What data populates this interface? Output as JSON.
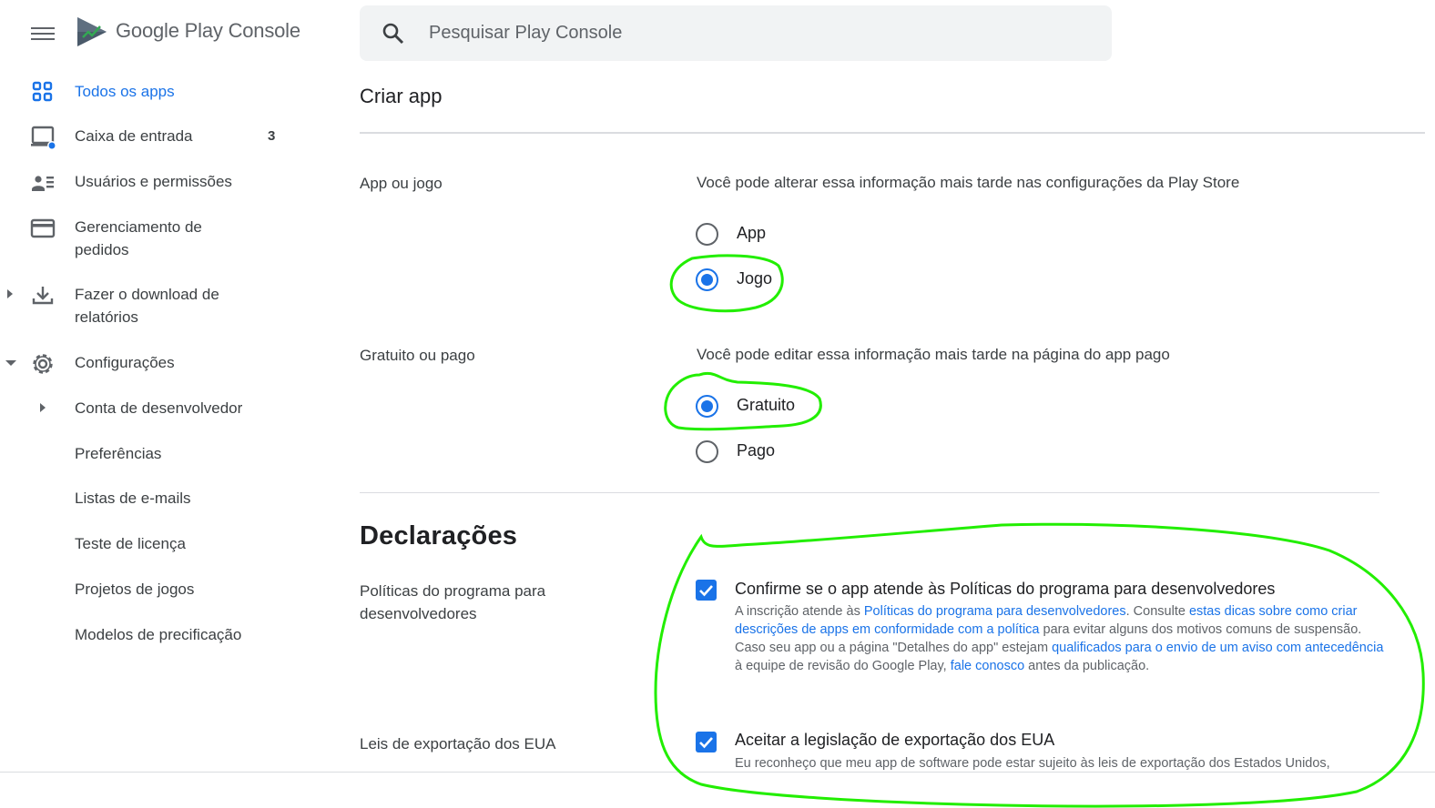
{
  "app": {
    "brand_google_play": "Google Play",
    "brand_console": "Console"
  },
  "search": {
    "placeholder": "Pesquisar Play Console"
  },
  "sidebar": {
    "items": [
      {
        "label": "Todos os apps"
      },
      {
        "label": "Caixa de entrada",
        "badge": "3"
      },
      {
        "label": "Usuários e permissões"
      },
      {
        "label": "Gerenciamento de pedidos"
      },
      {
        "label": "Fazer o download de relatórios"
      },
      {
        "label": "Configurações"
      },
      {
        "label": "Conta de desenvolvedor"
      },
      {
        "label": "Preferências"
      },
      {
        "label": "Listas de e-mails"
      },
      {
        "label": "Teste de licença"
      },
      {
        "label": "Projetos de jogos"
      },
      {
        "label": "Modelos de precificação"
      }
    ]
  },
  "main": {
    "title": "Criar app",
    "app_or_game": {
      "label": "App ou jogo",
      "hint": "Você pode alterar essa informação mais tarde nas configurações da Play Store",
      "options": [
        "App",
        "Jogo"
      ],
      "selected": "Jogo"
    },
    "free_or_paid": {
      "label": "Gratuito ou pago",
      "hint": "Você pode editar essa informação mais tarde na página do app pago",
      "options": [
        "Gratuito",
        "Pago"
      ],
      "selected": "Gratuito"
    },
    "declarations": {
      "heading": "Declarações",
      "policies": {
        "label": "Políticas do programa para desenvolvedores",
        "title": "Confirme se o app atende às Políticas do programa para desenvolvedores",
        "d1": "A inscrição atende às ",
        "l1": "Políticas do programa para desenvolvedores",
        "d2": ". Consulte ",
        "l2": "estas dicas sobre como criar descrições de apps em conformidade com a política",
        "d3": " para evitar alguns dos motivos comuns de suspensão. Caso seu app ou a página \"Detalhes do app\" estejam ",
        "l3": "qualificados para o envio de um aviso com antecedência",
        "d4": " à equipe de revisão do Google Play, ",
        "l4": "fale conosco",
        "d5": " antes da publicação.",
        "checked": true
      },
      "export": {
        "label": "Leis de exportação dos EUA",
        "title": "Aceitar a legislação de exportação dos EUA",
        "desc": "Eu reconheço que meu app de software pode estar sujeito às leis de exportação dos Estados Unidos,",
        "checked": true
      }
    }
  },
  "colors": {
    "accent": "#1a73e8",
    "annotation": "#22ee00"
  }
}
